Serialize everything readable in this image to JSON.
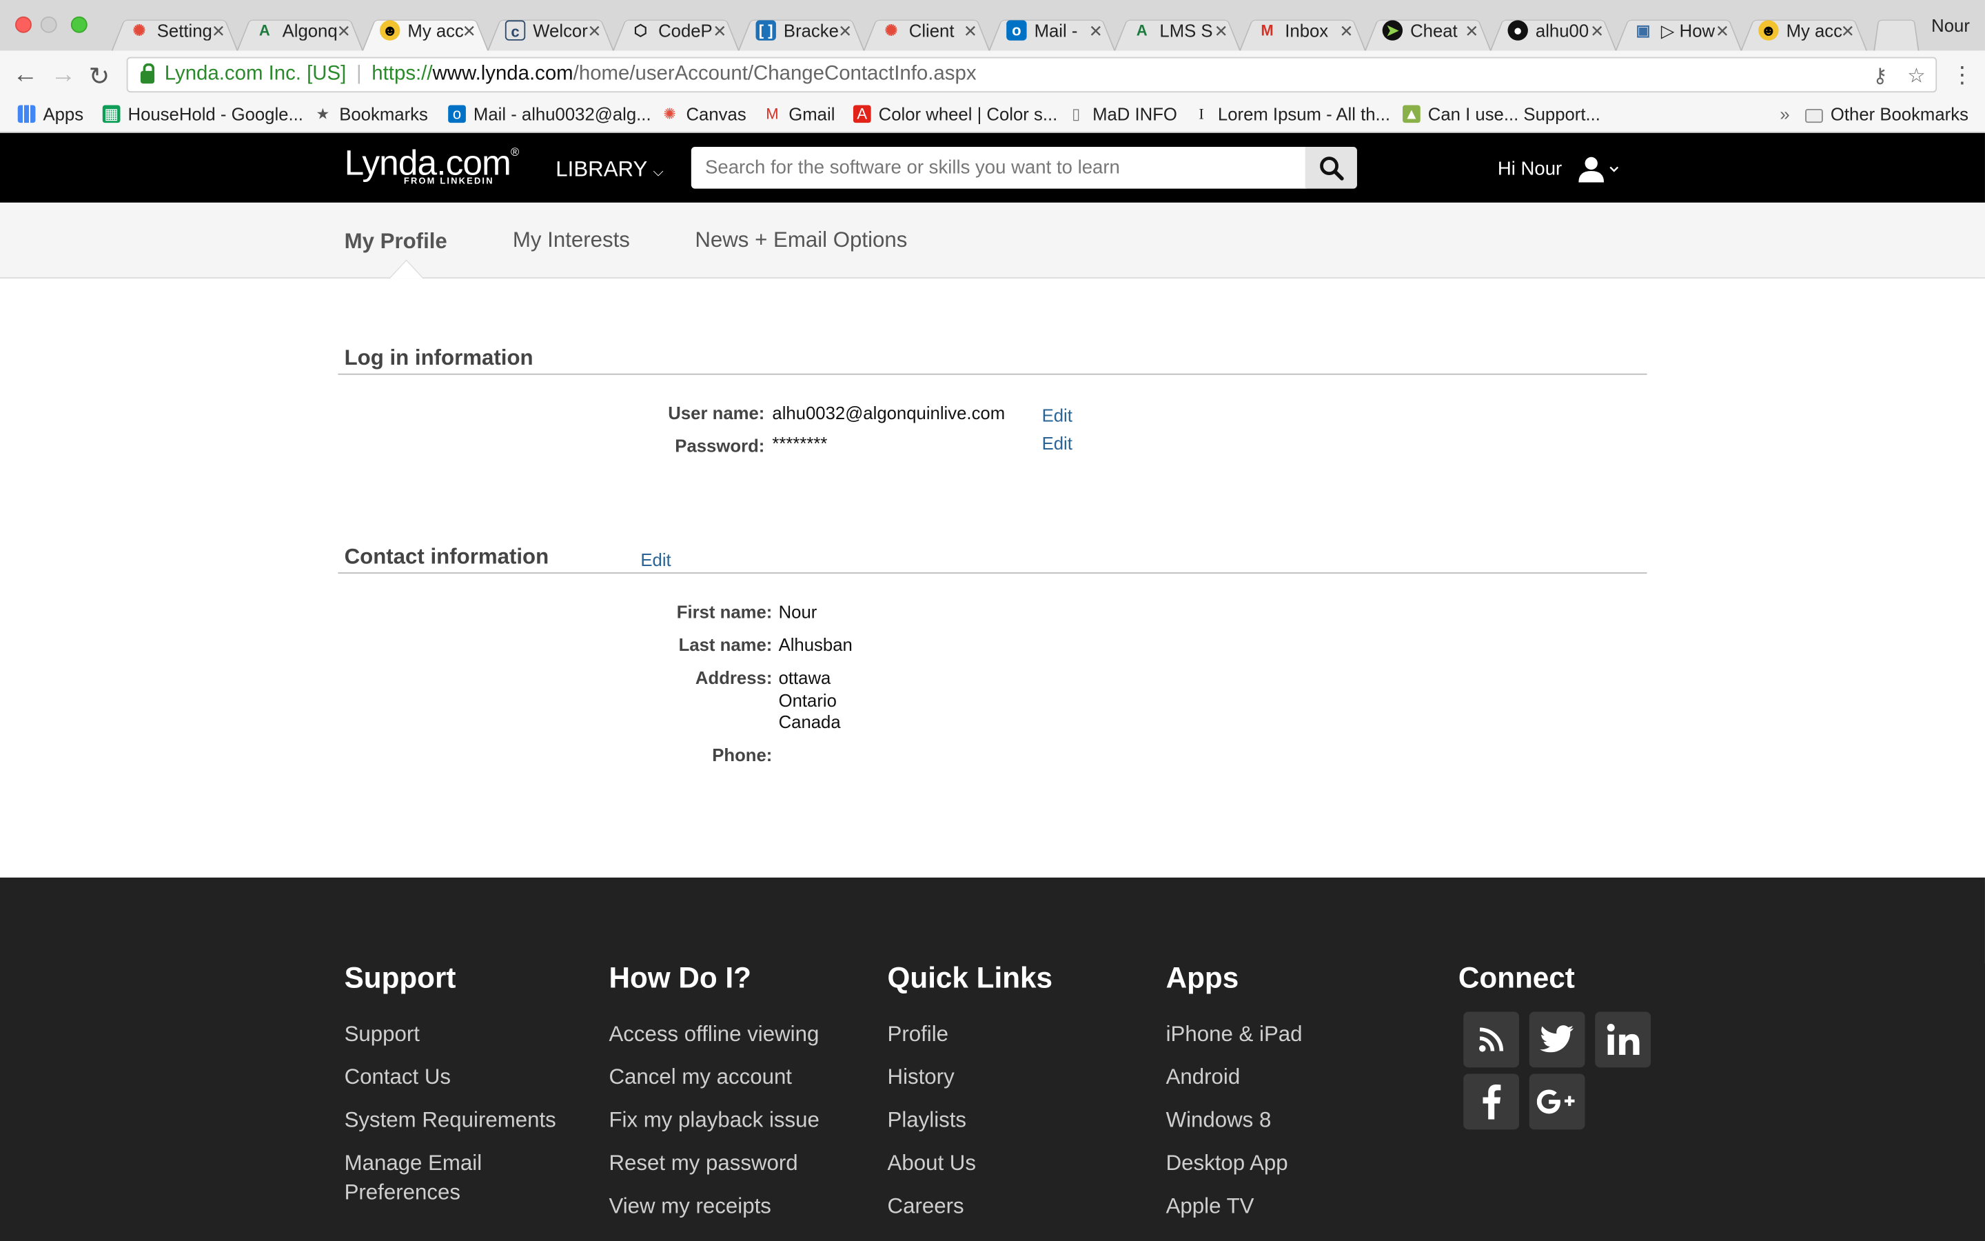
{
  "browser": {
    "tabs": [
      {
        "title": "Setting",
        "icon": "canvas-icon",
        "color": "#e34a3a"
      },
      {
        "title": "Algonq",
        "icon": "algonquin-icon",
        "color": "#1c7a3c"
      },
      {
        "title": "My acc",
        "icon": "lynda-icon",
        "color": "#f2c32e"
      },
      {
        "title": "Welcor",
        "icon": "welcome-icon",
        "color": "#2c4a6b"
      },
      {
        "title": "CodeP",
        "icon": "codepen-icon",
        "color": "#222222"
      },
      {
        "title": "Bracke",
        "icon": "brackets-icon",
        "color": "#1d71b8"
      },
      {
        "title": "Client",
        "icon": "canvas-icon",
        "color": "#e34a3a"
      },
      {
        "title": "Mail -",
        "icon": "outlook-icon",
        "color": "#0072c6"
      },
      {
        "title": "LMS S",
        "icon": "algonquin-icon",
        "color": "#1c7a3c"
      },
      {
        "title": "Inbox",
        "icon": "gmail-icon",
        "color": "#d93025"
      },
      {
        "title": "Cheat",
        "icon": "cheat-icon",
        "color": "#111111"
      },
      {
        "title": "alhu00",
        "icon": "github-icon",
        "color": "#111111"
      },
      {
        "title": "How",
        "icon": "video-icon",
        "color": "#3a6ea5"
      },
      {
        "title": "My acc",
        "icon": "lynda-icon",
        "color": "#f2c32e"
      }
    ],
    "profile_name": "Nour",
    "secure_label": "Lynda.com Inc. [US]",
    "url_scheme": "https://",
    "url_host": "www.lynda.com",
    "url_path": "/home/userAccount/ChangeContactInfo.aspx",
    "bookmarks": [
      {
        "label": "Apps",
        "icon": "apps-grid-icon"
      },
      {
        "label": "HouseHold - Google...",
        "icon": "sheets-icon"
      },
      {
        "label": "Bookmarks",
        "icon": "star-icon"
      },
      {
        "label": "Mail - alhu0032@alg...",
        "icon": "outlook-icon"
      },
      {
        "label": "Canvas",
        "icon": "canvas-icon"
      },
      {
        "label": "Gmail",
        "icon": "gmail-icon"
      },
      {
        "label": "Color wheel | Color s...",
        "icon": "adobe-icon"
      },
      {
        "label": "MaD INFO",
        "icon": "page-icon"
      },
      {
        "label": "Lorem Ipsum - All th...",
        "icon": "lorem-icon"
      },
      {
        "label": "Can I use... Support...",
        "icon": "caniuse-icon"
      }
    ],
    "bookmarks_more": "»",
    "other_bookmarks": "Other Bookmarks"
  },
  "header": {
    "logo": "Lynda.com",
    "logo_reg": "®",
    "logo_sub": "FROM LINKEDIN",
    "library": "LIBRARY",
    "search_placeholder": "Search for the software or skills you want to learn",
    "greeting": "Hi Nour"
  },
  "profile_tabs": [
    "My Profile",
    "My Interests",
    "News + Email Options"
  ],
  "login": {
    "title": "Log in information",
    "username_label": "User name:",
    "username": "alhu0032@algonquinlive.com",
    "password_label": "Password:",
    "password": "********",
    "edit": "Edit"
  },
  "contact": {
    "title": "Contact information",
    "edit": "Edit",
    "first_name_label": "First name:",
    "first_name": "Nour",
    "last_name_label": "Last name:",
    "last_name": "Alhusban",
    "address_label": "Address:",
    "address_lines": [
      "ottawa",
      "Ontario",
      "Canada"
    ],
    "phone_label": "Phone:",
    "phone": ""
  },
  "footer": {
    "columns": [
      {
        "title": "Support",
        "links": [
          "Support",
          "Contact Us",
          "System Requirements",
          "Manage Email",
          "Preferences"
        ]
      },
      {
        "title": "How Do I?",
        "links": [
          "Access offline viewing",
          "Cancel my account",
          "Fix my playback issue",
          "Reset my password",
          "View my receipts"
        ]
      },
      {
        "title": "Quick Links",
        "links": [
          "Profile",
          "History",
          "Playlists",
          "About Us",
          "Careers"
        ]
      },
      {
        "title": "Apps",
        "links": [
          "iPhone & iPad",
          "Android",
          "Windows 8",
          "Desktop App",
          "Apple TV"
        ]
      },
      {
        "title": "Connect",
        "links": []
      }
    ],
    "social": [
      "rss-icon",
      "twitter-icon",
      "linkedin-icon",
      "facebook-icon",
      "google-plus-icon"
    ]
  }
}
